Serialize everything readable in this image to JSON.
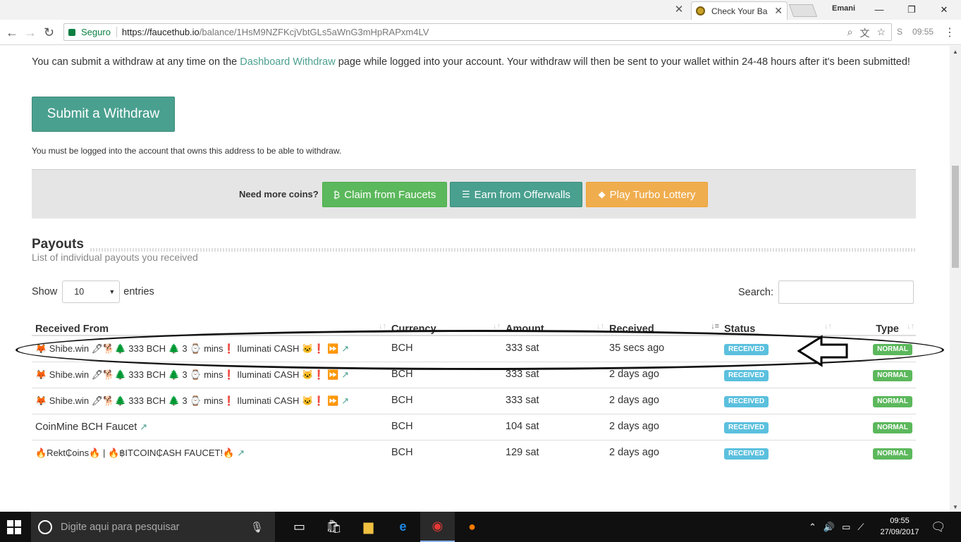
{
  "browser": {
    "tab_title": "Check Your Ba",
    "profile_name": "Emani",
    "secure_label": "Seguro",
    "url_host": "https://faucethub.io",
    "url_path": "/balance/1HsM9NZFKcjVbtGLs5aWnG3mHpRAPxm4LV",
    "clock_ext": "09:55"
  },
  "intro": {
    "text_before": "You can submit a withdraw at any time on the ",
    "link": "Dashboard Withdraw",
    "text_after": " page while logged into your account. Your withdraw will then be sent to your wallet within 24-48 hours after it's been submitted!"
  },
  "submit_label": "Submit a Withdraw",
  "note": "You must be logged into the account that owns this address to be able to withdraw.",
  "promo": {
    "label": "Need more coins?",
    "claim": "Claim from Faucets",
    "earn": "Earn from Offerwalls",
    "lottery": "Play Turbo Lottery"
  },
  "payouts": {
    "title": "Payouts",
    "subtitle": "List of individual payouts you received",
    "show_label": "Show",
    "entries_value": "10",
    "entries_label": "entries",
    "search_label": "Search:",
    "columns": [
      "Received From",
      "Currency",
      "Amount",
      "Received",
      "Status",
      "Type"
    ],
    "rows": [
      {
        "from": "🦊 Shibe.win 🖊🐕🌲 333 BCH 🌲 3 ⌚ mins❗ Iluminati CASH 🐱❗ ⏩",
        "currency": "BCH",
        "amount": "333 sat",
        "received": "35 secs ago",
        "status": "RECEIVED",
        "type": "NORMAL"
      },
      {
        "from": "🦊 Shibe.win 🖊🐕🌲 333 BCH 🌲 3 ⌚ mins❗ Iluminati CASH 🐱❗ ⏩",
        "currency": "BCH",
        "amount": "333 sat",
        "received": "2 days ago",
        "status": "RECEIVED",
        "type": "NORMAL"
      },
      {
        "from": "🦊 Shibe.win 🖊🐕🌲 333 BCH 🌲 3 ⌚ mins❗ Iluminati CASH 🐱❗ ⏩",
        "currency": "BCH",
        "amount": "333 sat",
        "received": "2 days ago",
        "status": "RECEIVED",
        "type": "NORMAL"
      },
      {
        "from": "CoinMine BCH Faucet",
        "currency": "BCH",
        "amount": "104 sat",
        "received": "2 days ago",
        "status": "RECEIVED",
        "type": "NORMAL"
      },
      {
        "from": "🔥Rekt₵oins🔥 | 🔥฿ITCOIN₵ASH FAUCET!🔥",
        "currency": "BCH",
        "amount": "129 sat",
        "received": "2 days ago",
        "status": "RECEIVED",
        "type": "NORMAL"
      }
    ]
  },
  "taskbar": {
    "search_placeholder": "Digite aqui para pesquisar",
    "time": "09:55",
    "date": "27/09/2017"
  },
  "colors": {
    "teal": "#4aa08f",
    "green": "#5cb85c",
    "orange": "#f0ad4e",
    "info": "#5bc0de"
  },
  "icons": [
    "back-icon",
    "forward-icon",
    "reload-icon",
    "lock-icon",
    "zoom-icon",
    "translate-icon",
    "star-icon",
    "external-link-icon",
    "bitcoin-icon",
    "list-icon",
    "ticket-icon",
    "windows-start-icon",
    "cortana-icon",
    "mic-icon",
    "task-view-icon",
    "store-icon",
    "folder-icon",
    "edge-icon",
    "chrome-icon",
    "firefox-icon",
    "notification-icon"
  ]
}
